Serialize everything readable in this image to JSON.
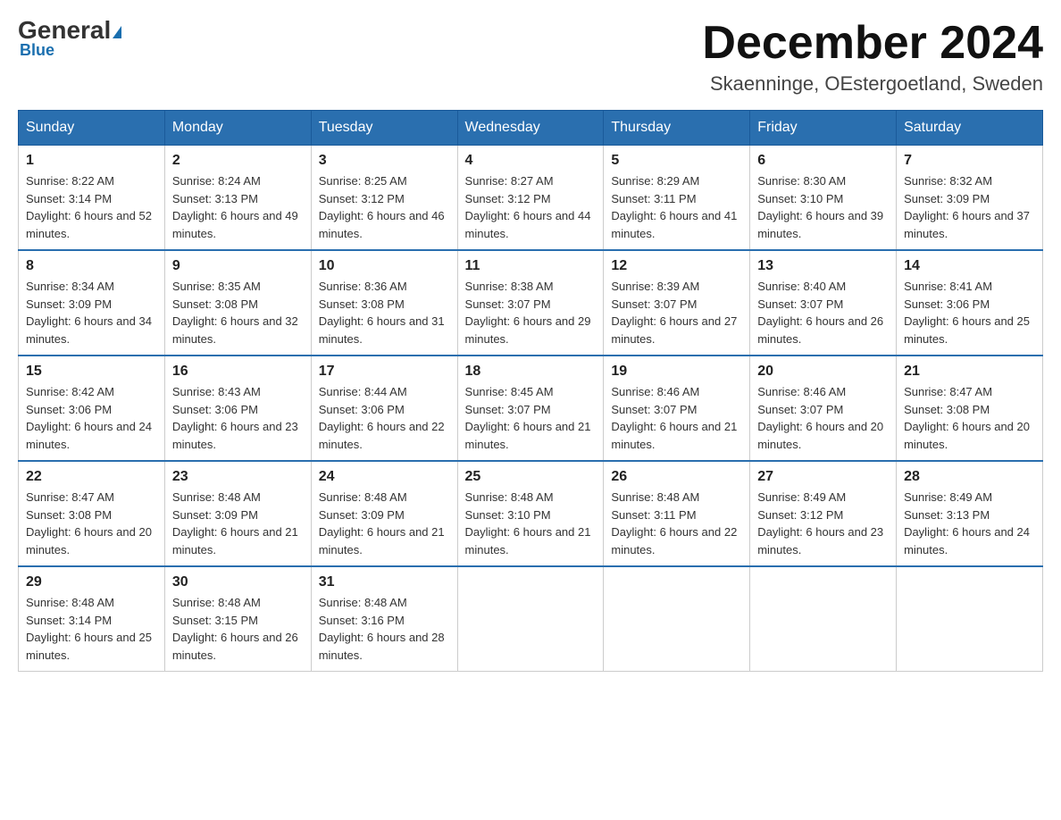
{
  "header": {
    "logo_general": "General",
    "logo_blue": "Blue",
    "title": "December 2024",
    "subtitle": "Skaenninge, OEstergoetland, Sweden"
  },
  "weekdays": [
    "Sunday",
    "Monday",
    "Tuesday",
    "Wednesday",
    "Thursday",
    "Friday",
    "Saturday"
  ],
  "weeks": [
    [
      {
        "day": "1",
        "sunrise": "8:22 AM",
        "sunset": "3:14 PM",
        "daylight": "6 hours and 52 minutes."
      },
      {
        "day": "2",
        "sunrise": "8:24 AM",
        "sunset": "3:13 PM",
        "daylight": "6 hours and 49 minutes."
      },
      {
        "day": "3",
        "sunrise": "8:25 AM",
        "sunset": "3:12 PM",
        "daylight": "6 hours and 46 minutes."
      },
      {
        "day": "4",
        "sunrise": "8:27 AM",
        "sunset": "3:12 PM",
        "daylight": "6 hours and 44 minutes."
      },
      {
        "day": "5",
        "sunrise": "8:29 AM",
        "sunset": "3:11 PM",
        "daylight": "6 hours and 41 minutes."
      },
      {
        "day": "6",
        "sunrise": "8:30 AM",
        "sunset": "3:10 PM",
        "daylight": "6 hours and 39 minutes."
      },
      {
        "day": "7",
        "sunrise": "8:32 AM",
        "sunset": "3:09 PM",
        "daylight": "6 hours and 37 minutes."
      }
    ],
    [
      {
        "day": "8",
        "sunrise": "8:34 AM",
        "sunset": "3:09 PM",
        "daylight": "6 hours and 34 minutes."
      },
      {
        "day": "9",
        "sunrise": "8:35 AM",
        "sunset": "3:08 PM",
        "daylight": "6 hours and 32 minutes."
      },
      {
        "day": "10",
        "sunrise": "8:36 AM",
        "sunset": "3:08 PM",
        "daylight": "6 hours and 31 minutes."
      },
      {
        "day": "11",
        "sunrise": "8:38 AM",
        "sunset": "3:07 PM",
        "daylight": "6 hours and 29 minutes."
      },
      {
        "day": "12",
        "sunrise": "8:39 AM",
        "sunset": "3:07 PM",
        "daylight": "6 hours and 27 minutes."
      },
      {
        "day": "13",
        "sunrise": "8:40 AM",
        "sunset": "3:07 PM",
        "daylight": "6 hours and 26 minutes."
      },
      {
        "day": "14",
        "sunrise": "8:41 AM",
        "sunset": "3:06 PM",
        "daylight": "6 hours and 25 minutes."
      }
    ],
    [
      {
        "day": "15",
        "sunrise": "8:42 AM",
        "sunset": "3:06 PM",
        "daylight": "6 hours and 24 minutes."
      },
      {
        "day": "16",
        "sunrise": "8:43 AM",
        "sunset": "3:06 PM",
        "daylight": "6 hours and 23 minutes."
      },
      {
        "day": "17",
        "sunrise": "8:44 AM",
        "sunset": "3:06 PM",
        "daylight": "6 hours and 22 minutes."
      },
      {
        "day": "18",
        "sunrise": "8:45 AM",
        "sunset": "3:07 PM",
        "daylight": "6 hours and 21 minutes."
      },
      {
        "day": "19",
        "sunrise": "8:46 AM",
        "sunset": "3:07 PM",
        "daylight": "6 hours and 21 minutes."
      },
      {
        "day": "20",
        "sunrise": "8:46 AM",
        "sunset": "3:07 PM",
        "daylight": "6 hours and 20 minutes."
      },
      {
        "day": "21",
        "sunrise": "8:47 AM",
        "sunset": "3:08 PM",
        "daylight": "6 hours and 20 minutes."
      }
    ],
    [
      {
        "day": "22",
        "sunrise": "8:47 AM",
        "sunset": "3:08 PM",
        "daylight": "6 hours and 20 minutes."
      },
      {
        "day": "23",
        "sunrise": "8:48 AM",
        "sunset": "3:09 PM",
        "daylight": "6 hours and 21 minutes."
      },
      {
        "day": "24",
        "sunrise": "8:48 AM",
        "sunset": "3:09 PM",
        "daylight": "6 hours and 21 minutes."
      },
      {
        "day": "25",
        "sunrise": "8:48 AM",
        "sunset": "3:10 PM",
        "daylight": "6 hours and 21 minutes."
      },
      {
        "day": "26",
        "sunrise": "8:48 AM",
        "sunset": "3:11 PM",
        "daylight": "6 hours and 22 minutes."
      },
      {
        "day": "27",
        "sunrise": "8:49 AM",
        "sunset": "3:12 PM",
        "daylight": "6 hours and 23 minutes."
      },
      {
        "day": "28",
        "sunrise": "8:49 AM",
        "sunset": "3:13 PM",
        "daylight": "6 hours and 24 minutes."
      }
    ],
    [
      {
        "day": "29",
        "sunrise": "8:48 AM",
        "sunset": "3:14 PM",
        "daylight": "6 hours and 25 minutes."
      },
      {
        "day": "30",
        "sunrise": "8:48 AM",
        "sunset": "3:15 PM",
        "daylight": "6 hours and 26 minutes."
      },
      {
        "day": "31",
        "sunrise": "8:48 AM",
        "sunset": "3:16 PM",
        "daylight": "6 hours and 28 minutes."
      },
      null,
      null,
      null,
      null
    ]
  ],
  "labels": {
    "sunrise_prefix": "Sunrise: ",
    "sunset_prefix": "Sunset: ",
    "daylight_prefix": "Daylight: "
  }
}
